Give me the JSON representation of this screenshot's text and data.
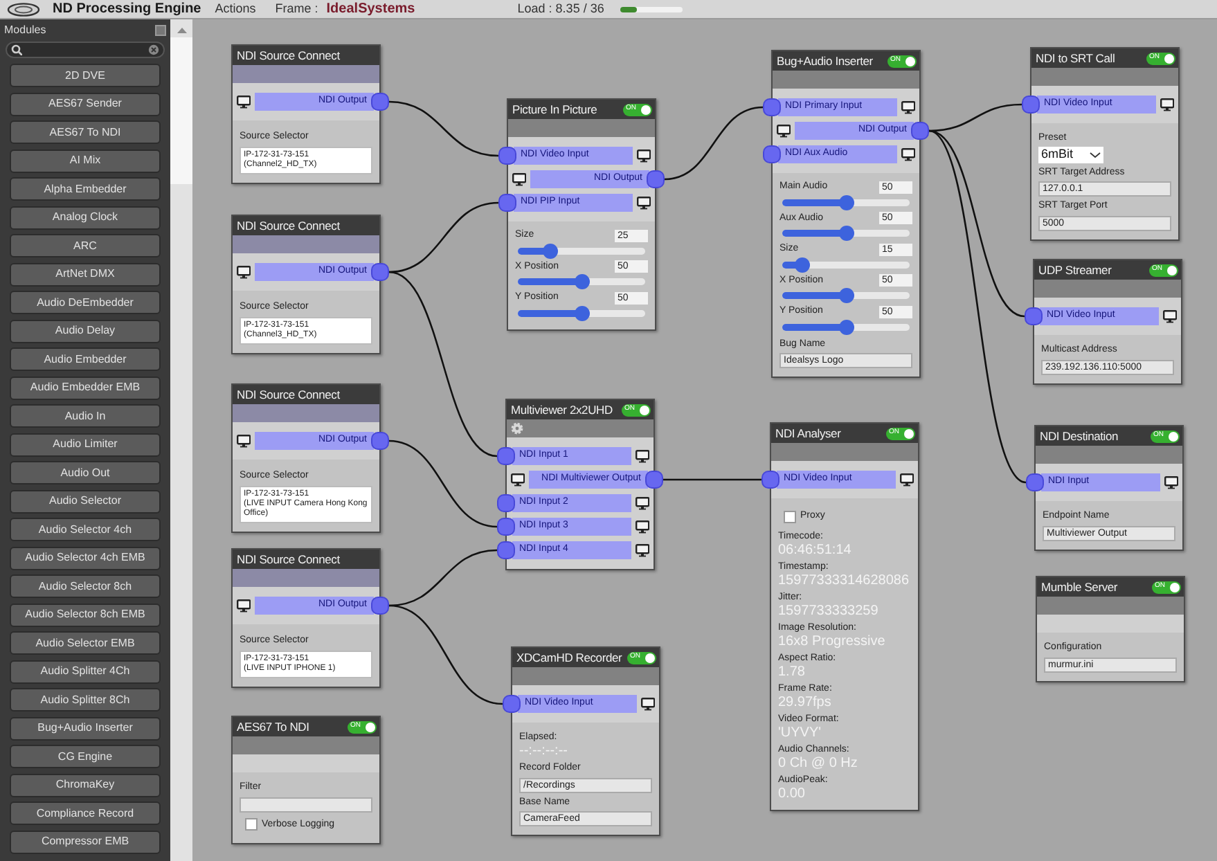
{
  "top_bar": {
    "app_title": "ND Processing Engine",
    "menu": [
      "Actions"
    ],
    "frame_label": "Frame :",
    "frame_name": "IdealSystems",
    "load_text": "Load : 8.35 / 36",
    "load_level": {
      "level": 0.25
    }
  },
  "sidebar": {
    "title": "Modules",
    "items": [
      "2D DVE",
      "AES67 Sender",
      "AES67 To NDI",
      "AI Mix",
      "Alpha Embedder",
      "Analog Clock",
      "ARC",
      "ArtNet DMX",
      "Audio DeEmbedder",
      "Audio Delay",
      "Audio Embedder",
      "Audio Embedder EMB",
      "Audio In",
      "Audio Limiter",
      "Audio Out",
      "Audio Selector",
      "Audio Selector 4ch",
      "Audio Selector 4ch EMB",
      "Audio Selector 8ch",
      "Audio Selector 8ch EMB",
      "Audio Selector EMB",
      "Audio Splitter 4Ch",
      "Audio Splitter 8Ch",
      "Bug+Audio Inserter",
      "CG Engine",
      "ChromaKey",
      "Compliance Record",
      "Compressor EMB"
    ]
  },
  "nodes": [
    {
      "title": "NDI Source Connect",
      "ports": [
        {
          "kind": "output",
          "label": "NDI Output"
        }
      ],
      "params": [
        {
          "kind": "textarea",
          "label": "Source Selector",
          "value": "IP-172-31-73-151\n(Channel2_HD_TX)"
        }
      ]
    },
    {
      "title": "NDI Source Connect",
      "ports": [
        {
          "kind": "output",
          "label": "NDI Output"
        }
      ],
      "params": [
        {
          "kind": "textarea",
          "label": "Source Selector",
          "value": "IP-172-31-73-151\n(Channel3_HD_TX)"
        }
      ]
    },
    {
      "title": "NDI Source Connect",
      "ports": [
        {
          "kind": "output",
          "label": "NDI Output"
        }
      ],
      "params": [
        {
          "kind": "textarea",
          "label": "Source Selector",
          "value": "IP-172-31-73-151\n(LIVE INPUT Camera Hong Kong Office)"
        }
      ]
    },
    {
      "title": "NDI Source Connect",
      "ports": [
        {
          "kind": "output",
          "label": "NDI Output"
        }
      ],
      "params": [
        {
          "kind": "textarea",
          "label": "Source Selector",
          "value": "IP-172-31-73-151\n(LIVE INPUT IPHONE 1)"
        }
      ]
    },
    {
      "title": "AES67 To NDI",
      "toggle": {
        "label": "ON",
        "on": true
      },
      "params": [
        {
          "kind": "field",
          "label": "Filter"
        },
        {
          "kind": "checkbox",
          "label": "Verbose Logging",
          "checked": false
        }
      ]
    },
    {
      "title": "Picture In Picture",
      "toggle": {
        "label": "ON",
        "on": true
      },
      "ports": [
        {
          "kind": "input",
          "label": "NDI Video Input"
        },
        {
          "kind": "output",
          "label": "NDI Output"
        },
        {
          "kind": "input",
          "label": "NDI PIP Input"
        }
      ],
      "params": [
        {
          "kind": "slider",
          "label": "Size",
          "value": "25",
          "level": 0.25
        },
        {
          "kind": "slider",
          "label": "X Position",
          "value": "50",
          "level": 0.5
        },
        {
          "kind": "slider",
          "label": "Y Position",
          "value": "50",
          "level": 0.5
        }
      ]
    },
    {
      "title": "Multiviewer 2x2UHD",
      "toggle": {
        "label": "ON",
        "on": true
      },
      "settings_icon": true,
      "ports": [
        {
          "kind": "input",
          "label": "NDI Input 1"
        },
        {
          "kind": "output",
          "label": "NDI Multiviewer Output"
        },
        {
          "kind": "input",
          "label": "NDI Input 2"
        },
        {
          "kind": "input",
          "label": "NDI Input 3"
        },
        {
          "kind": "input",
          "label": "NDI Input 4"
        }
      ]
    },
    {
      "title": "XDCamHD Recorder",
      "toggle": {
        "label": "ON",
        "on": true
      },
      "ports": [
        {
          "kind": "input",
          "label": "NDI Video Input"
        }
      ],
      "params": [
        {
          "kind": "stat",
          "label": "Elapsed:",
          "value": "--:--:--:--"
        },
        {
          "kind": "field",
          "label": "Record Folder",
          "value": "/Recordings"
        },
        {
          "kind": "field",
          "label": "Base Name",
          "value": "CameraFeed"
        }
      ]
    },
    {
      "title": "Bug+Audio Inserter",
      "toggle": {
        "label": "ON",
        "on": true
      },
      "ports": [
        {
          "kind": "input",
          "label": "NDI Primary Input"
        },
        {
          "kind": "output",
          "label": "NDI Output"
        },
        {
          "kind": "input",
          "label": "NDI Aux Audio"
        }
      ],
      "params": [
        {
          "kind": "slider",
          "label": "Main Audio",
          "value": "50",
          "level": 0.5
        },
        {
          "kind": "slider",
          "label": "Aux Audio",
          "value": "50",
          "level": 0.5
        },
        {
          "kind": "slider",
          "label": "Size",
          "value": "15",
          "level": 0.15
        },
        {
          "kind": "slider",
          "label": "X Position",
          "value": "50",
          "level": 0.5
        },
        {
          "kind": "slider",
          "label": "Y Position",
          "value": "50",
          "level": 0.5
        },
        {
          "kind": "field",
          "label": "Bug Name",
          "value": "Idealsys Logo"
        }
      ]
    },
    {
      "title": "NDI Analyser",
      "toggle": {
        "label": "ON",
        "on": true
      },
      "ports": [
        {
          "kind": "input",
          "label": "NDI Video Input"
        }
      ],
      "params": [
        {
          "kind": "checkbox",
          "label": "Proxy",
          "checked": false
        },
        {
          "kind": "stat",
          "label": "Timecode:",
          "value": "06:46:51:14"
        },
        {
          "kind": "stat",
          "label": "Timestamp:",
          "value": "15977333314628086"
        },
        {
          "kind": "stat",
          "label": "Jitter:",
          "value": "1597733333259"
        },
        {
          "kind": "stat",
          "label": "Image Resolution:",
          "value": "16x8 Progressive"
        },
        {
          "kind": "stat",
          "label": "Aspect Ratio:",
          "value": "1.78"
        },
        {
          "kind": "stat",
          "label": "Frame Rate:",
          "value": "29.97fps"
        },
        {
          "kind": "stat",
          "label": "Video Format:",
          "value": "'UYVY'"
        },
        {
          "kind": "stat",
          "label": "Audio Channels:",
          "value": "0 Ch @ 0 Hz"
        },
        {
          "kind": "stat",
          "label": "AudioPeak:",
          "value": "0.00"
        }
      ]
    },
    {
      "title": "NDI to SRT Call",
      "toggle": {
        "label": "ON",
        "on": true
      },
      "ports": [
        {
          "kind": "input",
          "label": "NDI Video Input"
        }
      ],
      "params": [
        {
          "kind": "dropdown",
          "label": "Preset",
          "value": "6mBit"
        },
        {
          "kind": "field",
          "label": "SRT Target Address",
          "value": "127.0.0.1"
        },
        {
          "kind": "field",
          "label": "SRT Target Port",
          "value": "5000"
        }
      ]
    },
    {
      "title": "UDP Streamer",
      "toggle": {
        "label": "ON",
        "on": true
      },
      "ports": [
        {
          "kind": "input",
          "label": "NDI Video Input"
        }
      ],
      "params": [
        {
          "kind": "field",
          "label": "Multicast Address",
          "value": "239.192.136.110:5000"
        }
      ]
    },
    {
      "title": "NDI Destination",
      "toggle": {
        "label": "ON",
        "on": true
      },
      "ports": [
        {
          "kind": "input",
          "label": "NDI Input"
        }
      ],
      "params": [
        {
          "kind": "field",
          "label": "Endpoint Name",
          "value": "Multiviewer Output"
        }
      ]
    },
    {
      "title": "Mumble Server",
      "toggle": {
        "label": "ON",
        "on": true
      },
      "params": [
        {
          "kind": "field",
          "label": "Configuration",
          "value": "murmur.ini"
        }
      ]
    }
  ]
}
